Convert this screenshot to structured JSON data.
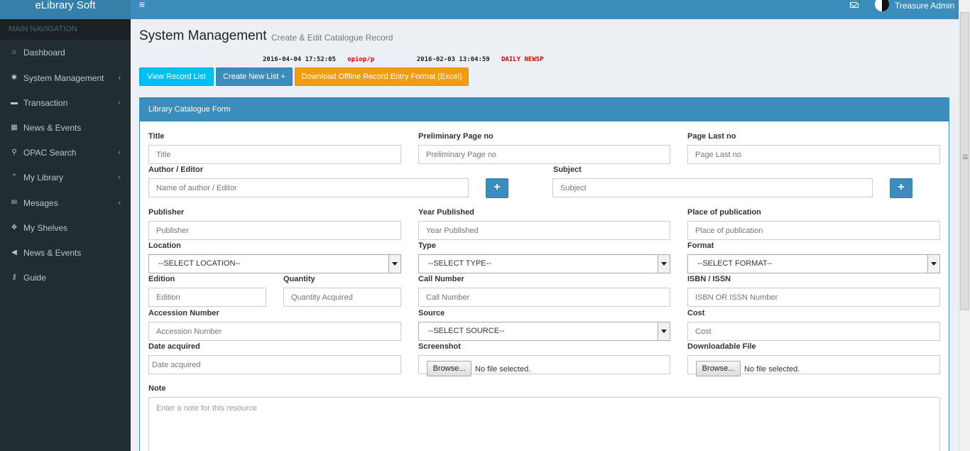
{
  "app": {
    "title": "eLibrary Soft"
  },
  "sidebar": {
    "header": "MAIN NAVIGATION",
    "items": [
      {
        "label": "Dashboard",
        "icon": "dashboard-icon",
        "glyph": "⌂",
        "chevron": false
      },
      {
        "label": "System Management",
        "icon": "gear-icon",
        "glyph": "✱",
        "chevron": true
      },
      {
        "label": "Transaction",
        "icon": "credit-card-icon",
        "glyph": "▬",
        "chevron": true
      },
      {
        "label": "News & Events",
        "icon": "calendar-icon",
        "glyph": "▦",
        "chevron": false
      },
      {
        "label": "OPAC Search",
        "icon": "search-icon",
        "glyph": "⚲",
        "chevron": true
      },
      {
        "label": "My Library",
        "icon": "graduation-cap-icon",
        "glyph": "⌃",
        "chevron": true
      },
      {
        "label": "Mesages",
        "icon": "envelope-icon",
        "glyph": "✉",
        "chevron": true
      },
      {
        "label": "My Shelves",
        "icon": "cubes-icon",
        "glyph": "❖",
        "chevron": false
      },
      {
        "label": "News & Events",
        "icon": "bullhorn-icon",
        "glyph": "◀",
        "chevron": false
      },
      {
        "label": "Guide",
        "icon": "key-icon",
        "glyph": "⚷",
        "chevron": false
      }
    ]
  },
  "topbar": {
    "menu_glyph": "≡",
    "user_name": "Treasure Admin"
  },
  "page": {
    "title": "System Management",
    "subtitle": "Create & Edit Catalogue Record"
  },
  "ticker": {
    "date1": "2016-04-04 17:52:05",
    "user1": "opiop/p",
    "date2": "2016-02-03 13:04:59",
    "title2": "DAILY NEWSPAPERS N"
  },
  "buttons": {
    "view": "View Record List",
    "create": "Create New List +",
    "download": "Download Offline Record Entry Format (Excel)"
  },
  "form": {
    "heading": "Library Catalogue Form",
    "plus": "+",
    "browse": "Browse...",
    "no_file": "No file selected.",
    "fields": {
      "title": {
        "label": "Title",
        "placeholder": "Title"
      },
      "prelim": {
        "label": "Preliminary Page no",
        "placeholder": "Preliminary Page no"
      },
      "lastpage": {
        "label": "Page Last no",
        "placeholder": "Page Last no"
      },
      "author": {
        "label": "Author / Editor",
        "placeholder": "Name of author / Editor"
      },
      "subject": {
        "label": "Subject",
        "placeholder": "Subject"
      },
      "publisher": {
        "label": "Publisher",
        "placeholder": "Publisher"
      },
      "year": {
        "label": "Year Published",
        "placeholder": "Year Published"
      },
      "place": {
        "label": "Place of publication",
        "placeholder": "Place of publication"
      },
      "location": {
        "label": "Location",
        "value": "--SELECT LOCATION--"
      },
      "type": {
        "label": "Type",
        "value": "--SELECT TYPE--"
      },
      "format": {
        "label": "Format",
        "value": "--SELECT FORMAT--"
      },
      "edition": {
        "label": "Edition",
        "placeholder": "Edition"
      },
      "quantity": {
        "label": "Quantity",
        "placeholder": "Quantity Acquired"
      },
      "callnumber": {
        "label": "Call Number",
        "placeholder": "Call Number"
      },
      "isbn": {
        "label": "ISBN / ISSN",
        "placeholder": "ISBN OR ISSN Number"
      },
      "accession": {
        "label": "Accession Number",
        "placeholder": "Accession Number"
      },
      "source": {
        "label": "Source",
        "value": "--SELECT SOURCE--"
      },
      "cost": {
        "label": "Cost",
        "placeholder": "Cost"
      },
      "date": {
        "label": "Date acquired",
        "placeholder": "Date acquired"
      },
      "screenshot": {
        "label": "Screenshot"
      },
      "download": {
        "label": "Downloadable File"
      },
      "note": {
        "label": "Note",
        "placeholder": "Enter a   note for this resource"
      }
    }
  }
}
